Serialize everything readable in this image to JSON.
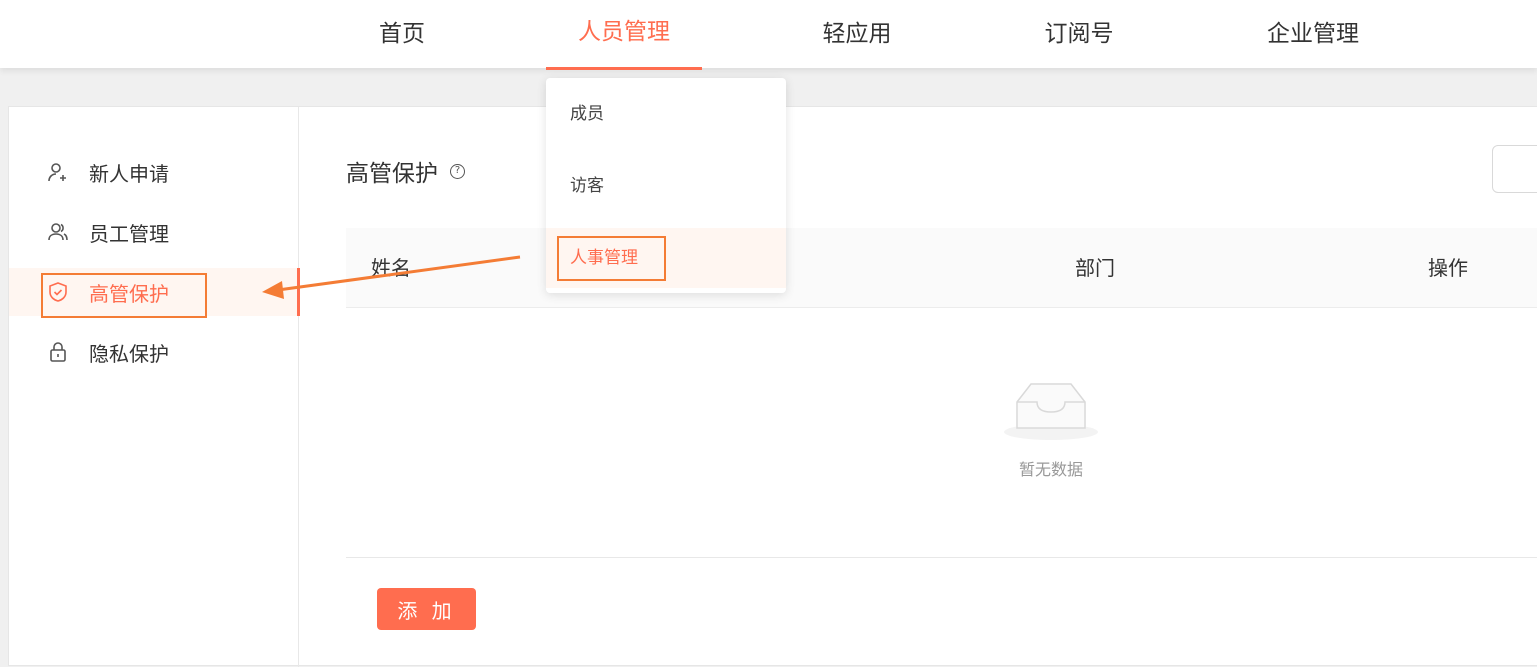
{
  "nav": {
    "items": [
      {
        "label": "首页"
      },
      {
        "label": "人员管理"
      },
      {
        "label": "轻应用"
      },
      {
        "label": "订阅号"
      },
      {
        "label": "企业管理"
      }
    ]
  },
  "dropdown": {
    "items": [
      {
        "label": "成员"
      },
      {
        "label": "访客"
      },
      {
        "label": "人事管理"
      }
    ]
  },
  "sidebar": {
    "items": [
      {
        "label": "新人申请",
        "icon": "user-add-icon"
      },
      {
        "label": "员工管理",
        "icon": "users-icon"
      },
      {
        "label": "高管保护",
        "icon": "shield-icon"
      },
      {
        "label": "隐私保护",
        "icon": "lock-icon"
      }
    ]
  },
  "main": {
    "title": "高管保护",
    "help_icon": "?",
    "table": {
      "columns": [
        "姓名",
        "部门",
        "操作"
      ],
      "rows": [],
      "empty_text": "暂无数据"
    },
    "add_button": "添 加"
  },
  "colors": {
    "accent": "#ff6d4f",
    "annotation": "#f47c35"
  }
}
